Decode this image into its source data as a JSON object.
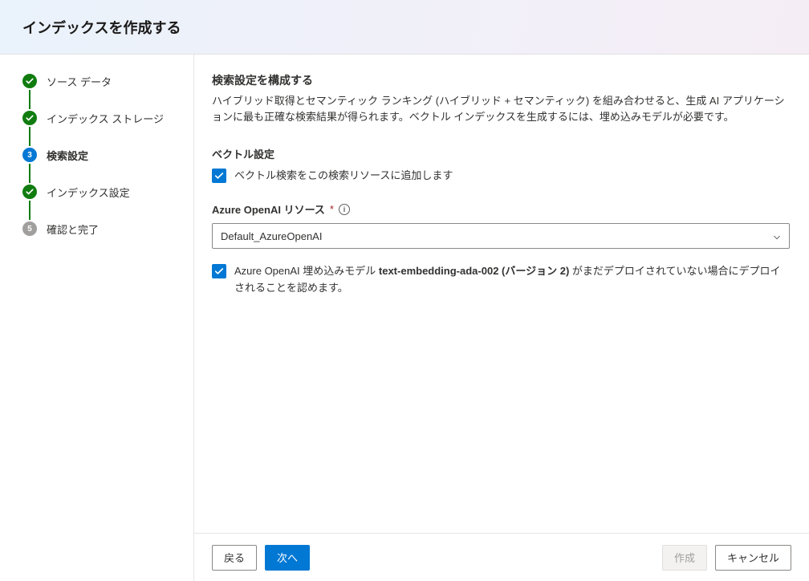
{
  "header": {
    "title": "インデックスを作成する"
  },
  "stepper": {
    "steps": [
      {
        "label": "ソース データ",
        "state": "done"
      },
      {
        "label": "インデックス ストレージ",
        "state": "done"
      },
      {
        "label": "検索設定",
        "state": "current",
        "number": "3"
      },
      {
        "label": "インデックス設定",
        "state": "done"
      },
      {
        "label": "確認と完了",
        "state": "pending",
        "number": "5"
      }
    ]
  },
  "content": {
    "section_title": "検索設定を構成する",
    "description": "ハイブリッド取得とセマンティック ランキング (ハイブリッド + セマンティック) を組み合わせると、生成 AI アプリケーションに最も正確な検索結果が得られます。ベクトル インデックスを生成するには、埋め込みモデルが必要です。",
    "vector_section_title": "ベクトル設定",
    "vector_checkbox_label": "ベクトル検索をこの検索リソースに追加します",
    "resource_field_label": "Azure OpenAI リソース",
    "required_marker": "*",
    "resource_value": "Default_AzureOpenAI",
    "ack_prefix": "Azure OpenAI 埋め込みモデル ",
    "ack_model": "text-embedding-ada-002 (バージョン 2)",
    "ack_suffix": " がまだデプロイされていない場合にデプロイされることを認めます。"
  },
  "footer": {
    "back": "戻る",
    "next": "次へ",
    "create": "作成",
    "cancel": "キャンセル"
  },
  "colors": {
    "primary": "#0078d4",
    "success": "#107c10",
    "muted": "#a19f9d"
  }
}
